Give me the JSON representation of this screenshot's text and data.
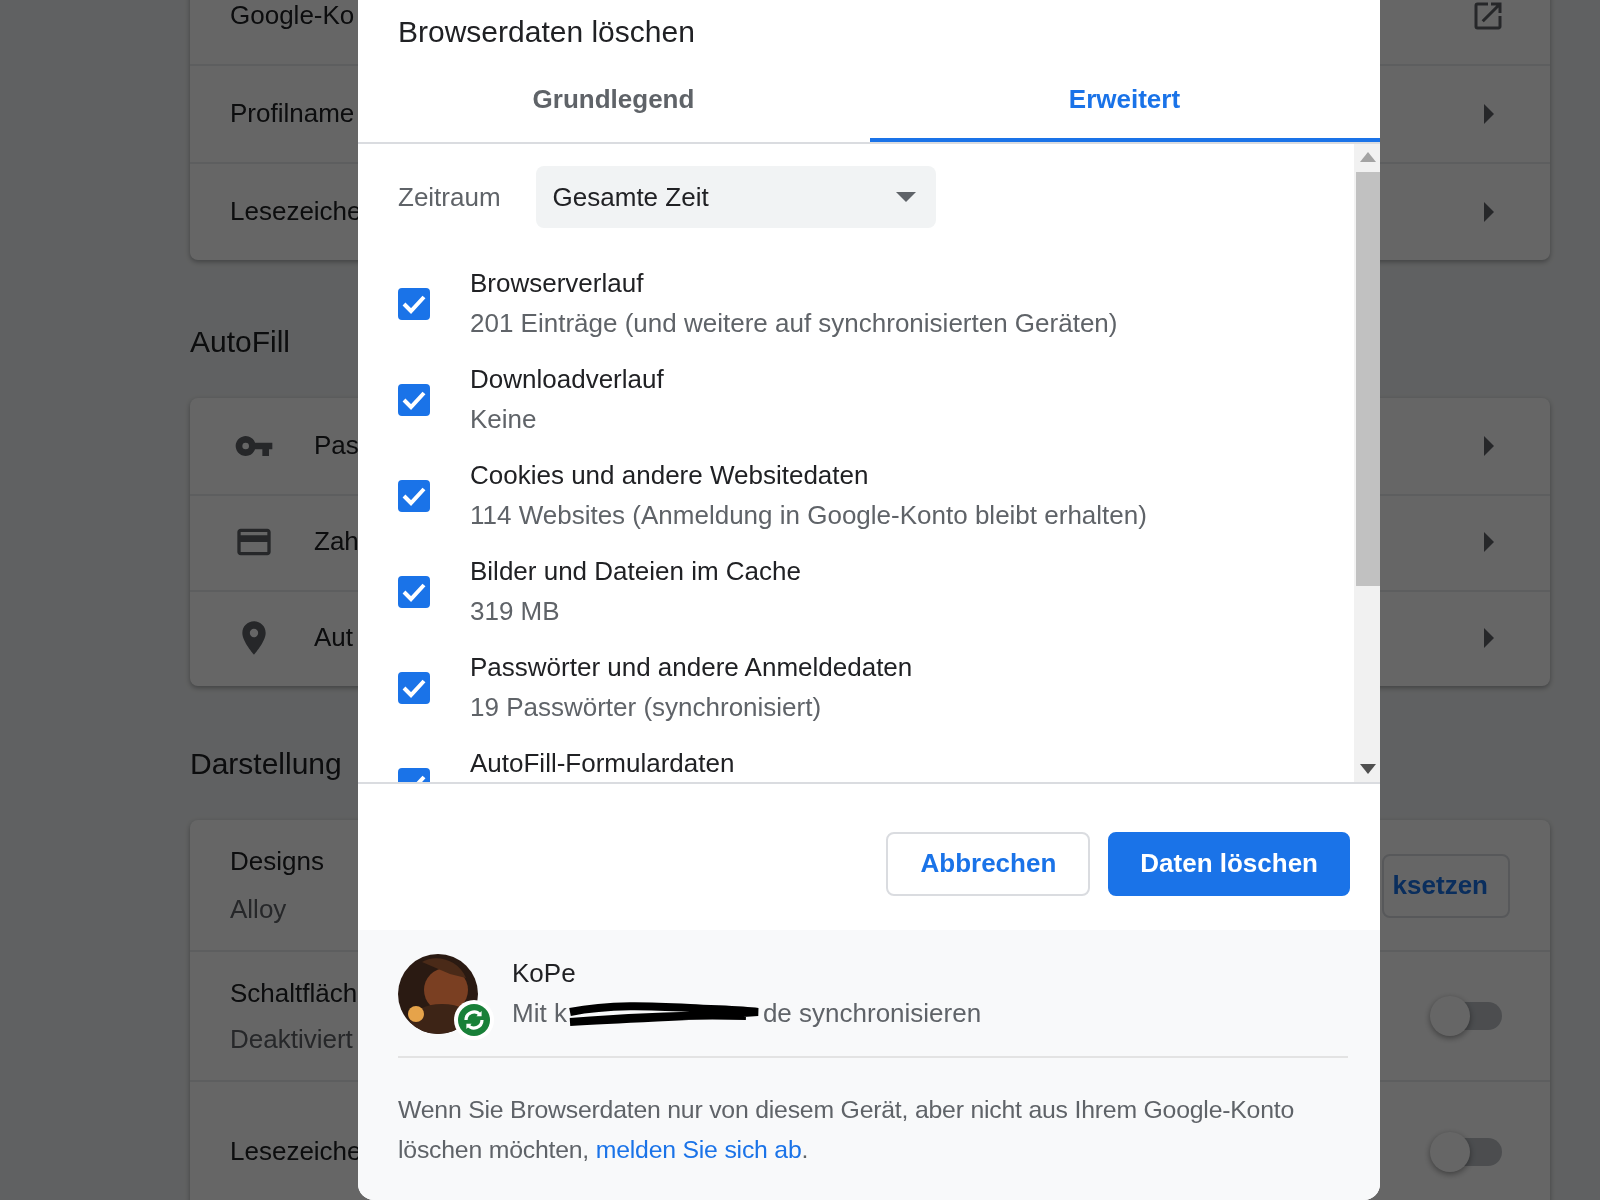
{
  "settings_page": {
    "sections": [
      {
        "rows": [
          {
            "label": "Google-Ko",
            "kind": "link"
          },
          {
            "label": "Profilname",
            "kind": "submenu"
          },
          {
            "label": "Lesezeiche",
            "kind": "submenu"
          }
        ]
      },
      {
        "heading": "AutoFill",
        "rows": [
          {
            "label": "Pas",
            "kind": "submenu"
          },
          {
            "label": "Zah",
            "kind": "submenu"
          },
          {
            "label": "Aut",
            "kind": "submenu"
          }
        ]
      },
      {
        "heading": "Darstellung",
        "rows": [
          {
            "label": "Designs",
            "sublabel": "Alloy",
            "kind": "button",
            "button_label": "ksetzen"
          },
          {
            "label": "Schaltfläch",
            "sublabel": "Deaktiviert",
            "kind": "toggle",
            "on": false
          },
          {
            "label": "Lesezeiche",
            "kind": "toggle",
            "on": false
          }
        ]
      }
    ]
  },
  "dialog": {
    "title": "Browserdaten löschen",
    "tabs": [
      {
        "label": "Grundlegend",
        "selected": false
      },
      {
        "label": "Erweitert",
        "selected": true
      }
    ],
    "time_range": {
      "label": "Zeitraum",
      "value": "Gesamte Zeit"
    },
    "items": [
      {
        "title": "Browserverlauf",
        "detail": "201 Einträge (und weitere auf synchronisierten Geräten)",
        "checked": true
      },
      {
        "title": "Downloadverlauf",
        "detail": "Keine",
        "checked": true
      },
      {
        "title": "Cookies und andere Websitedaten",
        "detail": "114 Websites (Anmeldung in Google-Konto bleibt erhalten)",
        "checked": true
      },
      {
        "title": "Bilder und Dateien im Cache",
        "detail": "319 MB",
        "checked": true
      },
      {
        "title": "Passwörter und andere Anmeldedaten",
        "detail": "19 Passwörter (synchronisiert)",
        "checked": true
      },
      {
        "title": "AutoFill-Formulardaten",
        "checked": true
      }
    ],
    "buttons": [
      {
        "label": "Abbrechen",
        "kind": "secondary"
      },
      {
        "label": "Daten löschen",
        "kind": "primary"
      }
    ],
    "account": {
      "name": "KoPe",
      "sync_before": "Mit k",
      "sync_after": "de synchronisieren"
    },
    "notice": {
      "text": "Wenn Sie Browserdaten nur von diesem Gerät, aber nicht aus Ihrem Google-Konto löschen möchten, ",
      "link": "melden Sie sich ab",
      "end": "."
    }
  }
}
